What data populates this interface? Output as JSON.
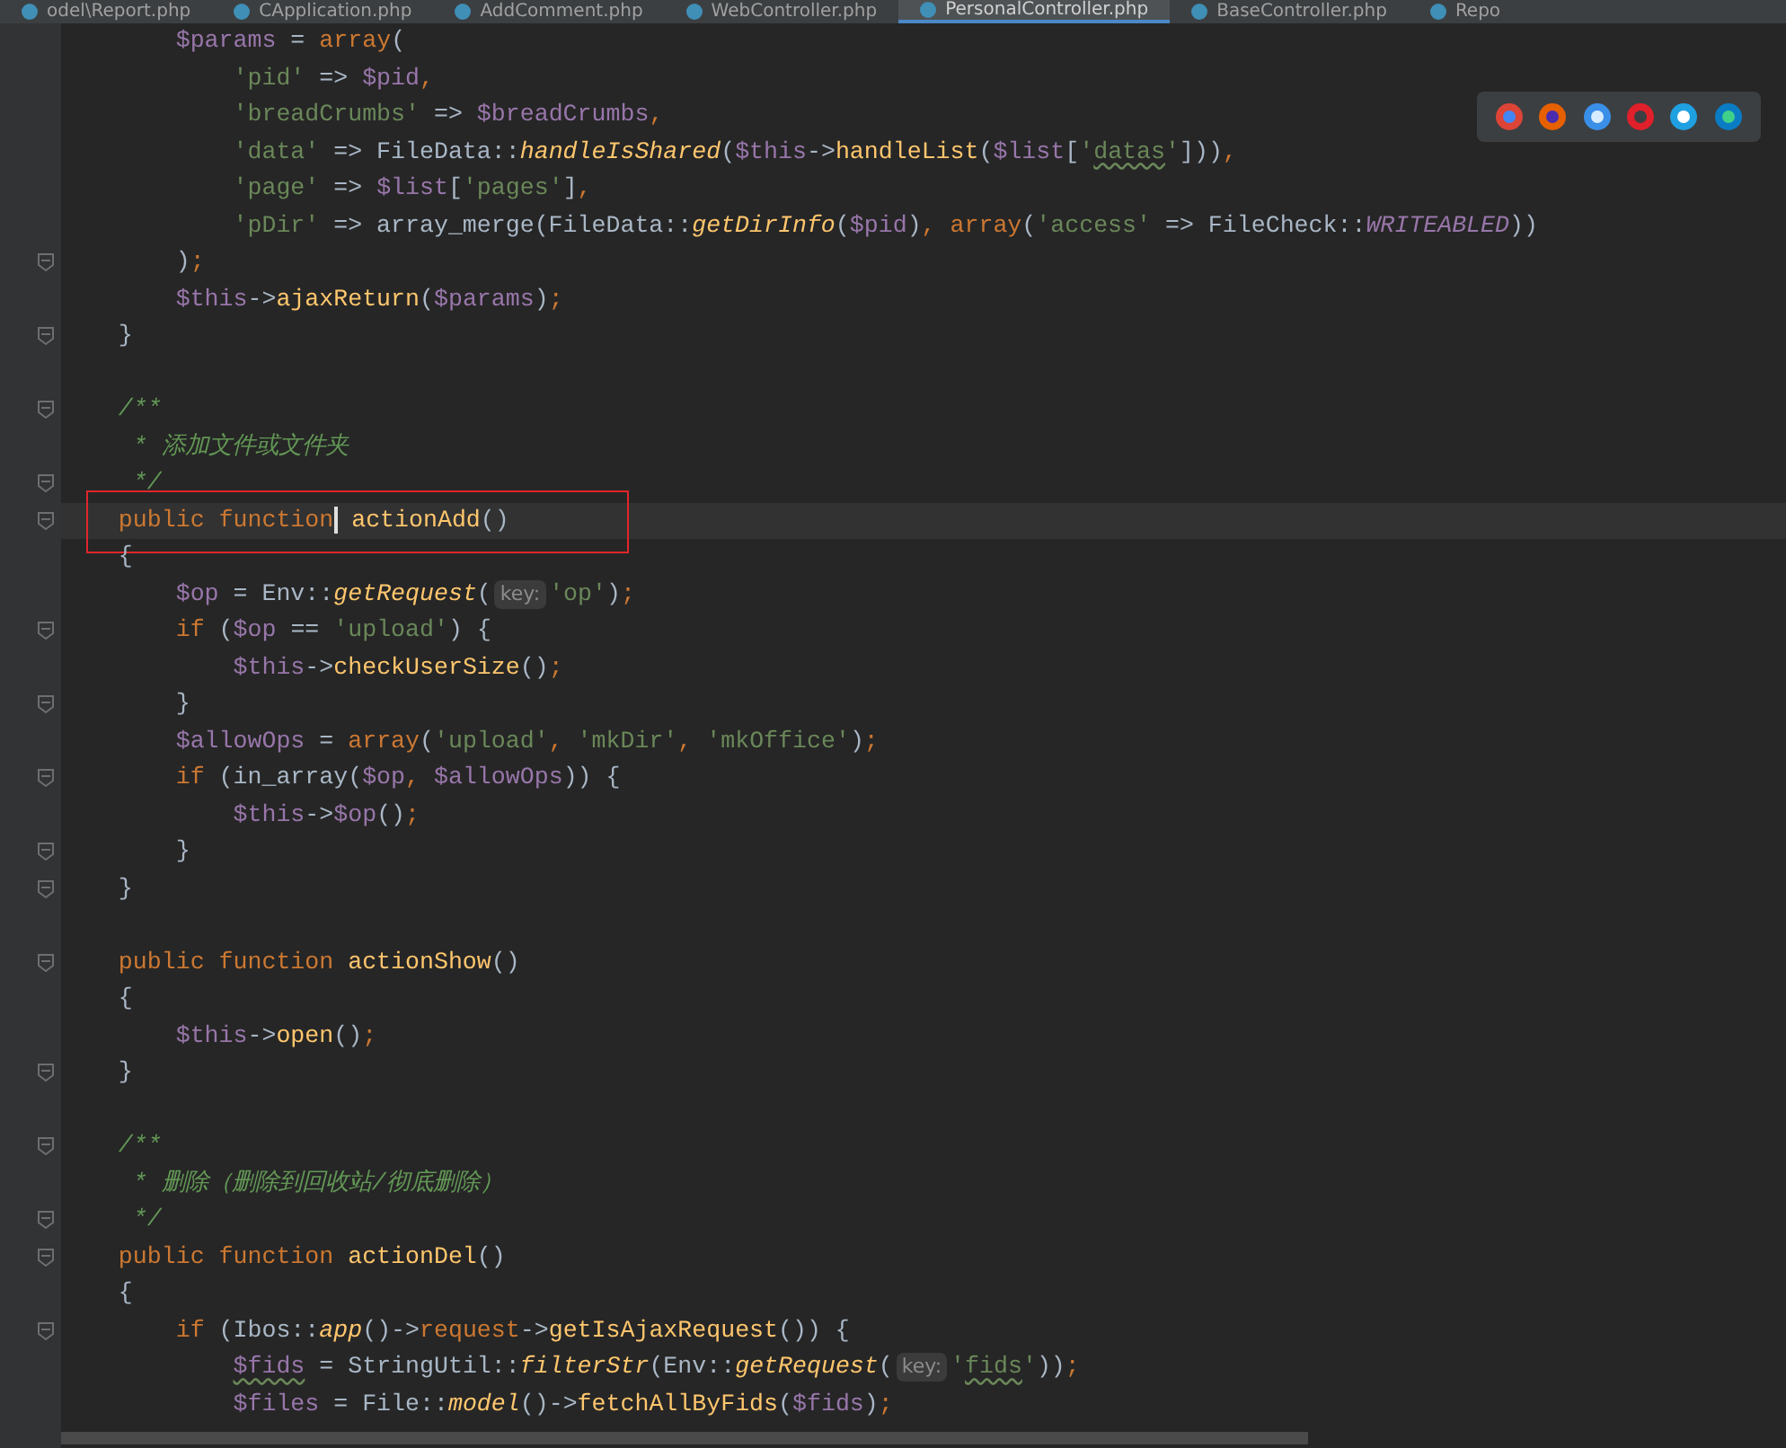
{
  "tabs": [
    {
      "label": "odel\\Report.php",
      "selected": false
    },
    {
      "label": "CApplication.php",
      "selected": false
    },
    {
      "label": "AddComment.php",
      "selected": false
    },
    {
      "label": "WebController.php",
      "selected": false
    },
    {
      "label": "PersonalController.php",
      "selected": true
    },
    {
      "label": "BaseController.php",
      "selected": false
    },
    {
      "label": "Repo",
      "selected": false
    }
  ],
  "editor": {
    "lines": [
      {
        "kind": "code",
        "tokens": [
          {
            "kind": "var",
            "text": "        $params"
          },
          {
            "kind": "plain",
            "text": " = "
          },
          {
            "kind": "keyword",
            "text": "array"
          },
          {
            "kind": "plain",
            "text": "("
          }
        ]
      },
      {
        "kind": "code",
        "tokens": [
          {
            "kind": "string",
            "text": "            'pid'"
          },
          {
            "kind": "plain",
            "text": " => "
          },
          {
            "kind": "var",
            "text": "$pid"
          },
          {
            "kind": "punct",
            "text": ","
          }
        ]
      },
      {
        "kind": "code",
        "tokens": [
          {
            "kind": "string",
            "text": "            'breadCrumbs'"
          },
          {
            "kind": "plain",
            "text": " => "
          },
          {
            "kind": "var",
            "text": "$breadCrumbs"
          },
          {
            "kind": "punct",
            "text": ","
          }
        ]
      },
      {
        "kind": "code",
        "tokens": [
          {
            "kind": "string",
            "text": "            'data'"
          },
          {
            "kind": "plain",
            "text": " => FileData::"
          },
          {
            "kind": "static",
            "text": "handleIsShared"
          },
          {
            "kind": "plain",
            "text": "("
          },
          {
            "kind": "var",
            "text": "$this"
          },
          {
            "kind": "plain",
            "text": "->"
          },
          {
            "kind": "method",
            "text": "handleList"
          },
          {
            "kind": "plain",
            "text": "("
          },
          {
            "kind": "var",
            "text": "$list"
          },
          {
            "kind": "plain",
            "text": "["
          },
          {
            "kind": "string",
            "text": "'"
          },
          {
            "kind": "string",
            "text": "datas",
            "typo": true
          },
          {
            "kind": "string",
            "text": "'"
          },
          {
            "kind": "plain",
            "text": "]))"
          },
          {
            "kind": "punct",
            "text": ","
          }
        ]
      },
      {
        "kind": "code",
        "tokens": [
          {
            "kind": "string",
            "text": "            'page'"
          },
          {
            "kind": "plain",
            "text": " => "
          },
          {
            "kind": "var",
            "text": "$list"
          },
          {
            "kind": "plain",
            "text": "["
          },
          {
            "kind": "string",
            "text": "'pages'"
          },
          {
            "kind": "plain",
            "text": "]"
          },
          {
            "kind": "punct",
            "text": ","
          }
        ]
      },
      {
        "kind": "code",
        "tokens": [
          {
            "kind": "string",
            "text": "            'pDir'"
          },
          {
            "kind": "plain",
            "text": " => array_merge(FileData::"
          },
          {
            "kind": "static",
            "text": "getDirInfo"
          },
          {
            "kind": "plain",
            "text": "("
          },
          {
            "kind": "var",
            "text": "$pid"
          },
          {
            "kind": "plain",
            "text": ")"
          },
          {
            "kind": "punct",
            "text": ","
          },
          {
            "kind": "keyword",
            "text": " array"
          },
          {
            "kind": "plain",
            "text": "("
          },
          {
            "kind": "string",
            "text": "'access'"
          },
          {
            "kind": "plain",
            "text": " => FileCheck::"
          },
          {
            "kind": "constant",
            "text": "WRITEABLED"
          },
          {
            "kind": "plain",
            "text": "))"
          }
        ]
      },
      {
        "kind": "code",
        "fold": true,
        "tokens": [
          {
            "kind": "plain",
            "text": "        )"
          },
          {
            "kind": "punct",
            "text": ";"
          }
        ]
      },
      {
        "kind": "code",
        "tokens": [
          {
            "kind": "var",
            "text": "        $this"
          },
          {
            "kind": "plain",
            "text": "->"
          },
          {
            "kind": "method",
            "text": "ajaxReturn"
          },
          {
            "kind": "plain",
            "text": "("
          },
          {
            "kind": "var",
            "text": "$params"
          },
          {
            "kind": "plain",
            "text": ")"
          },
          {
            "kind": "punct",
            "text": ";"
          }
        ]
      },
      {
        "kind": "code",
        "fold": true,
        "tokens": [
          {
            "kind": "plain",
            "text": "    }"
          }
        ]
      },
      {
        "kind": "blank"
      },
      {
        "kind": "code",
        "fold": true,
        "tokens": [
          {
            "kind": "comment",
            "text": "    /**"
          }
        ]
      },
      {
        "kind": "code",
        "tokens": [
          {
            "kind": "comment",
            "text": "     * 添加文件或文件夹"
          }
        ]
      },
      {
        "kind": "code",
        "fold": true,
        "tokens": [
          {
            "kind": "comment",
            "text": "     */"
          }
        ]
      },
      {
        "kind": "code",
        "fold": true,
        "current": true,
        "boxed": true,
        "tokens": [
          {
            "kind": "keyword",
            "text": "    public function",
            "caret": true
          },
          {
            "kind": "method",
            "text": " actionAdd"
          },
          {
            "kind": "plain",
            "text": "()"
          }
        ]
      },
      {
        "kind": "code",
        "tokens": [
          {
            "kind": "plain",
            "text": "    {"
          }
        ]
      },
      {
        "kind": "code",
        "tokens": [
          {
            "kind": "var",
            "text": "        $op"
          },
          {
            "kind": "plain",
            "text": " = Env::"
          },
          {
            "kind": "static",
            "text": "getRequest"
          },
          {
            "kind": "plain",
            "text": "("
          },
          {
            "kind": "hint",
            "text": "key:"
          },
          {
            "kind": "string",
            "text": "'op'"
          },
          {
            "kind": "plain",
            "text": ")"
          },
          {
            "kind": "punct",
            "text": ";"
          }
        ]
      },
      {
        "kind": "code",
        "fold": true,
        "tokens": [
          {
            "kind": "keyword",
            "text": "        if"
          },
          {
            "kind": "plain",
            "text": " ("
          },
          {
            "kind": "var",
            "text": "$op"
          },
          {
            "kind": "plain",
            "text": " == "
          },
          {
            "kind": "string",
            "text": "'upload'"
          },
          {
            "kind": "plain",
            "text": ") {"
          }
        ]
      },
      {
        "kind": "code",
        "tokens": [
          {
            "kind": "var",
            "text": "            $this"
          },
          {
            "kind": "plain",
            "text": "->"
          },
          {
            "kind": "method",
            "text": "checkUserSize"
          },
          {
            "kind": "plain",
            "text": "()"
          },
          {
            "kind": "punct",
            "text": ";"
          }
        ]
      },
      {
        "kind": "code",
        "fold": true,
        "tokens": [
          {
            "kind": "plain",
            "text": "        }"
          }
        ]
      },
      {
        "kind": "code",
        "tokens": [
          {
            "kind": "var",
            "text": "        $allowOps"
          },
          {
            "kind": "plain",
            "text": " = "
          },
          {
            "kind": "keyword",
            "text": "array"
          },
          {
            "kind": "plain",
            "text": "("
          },
          {
            "kind": "string",
            "text": "'upload'"
          },
          {
            "kind": "punct",
            "text": ","
          },
          {
            "kind": "string",
            "text": " 'mkDir'"
          },
          {
            "kind": "punct",
            "text": ","
          },
          {
            "kind": "string",
            "text": " 'mkOffice'"
          },
          {
            "kind": "plain",
            "text": ")"
          },
          {
            "kind": "punct",
            "text": ";"
          }
        ]
      },
      {
        "kind": "code",
        "fold": true,
        "tokens": [
          {
            "kind": "keyword",
            "text": "        if"
          },
          {
            "kind": "plain",
            "text": " (in_array("
          },
          {
            "kind": "var",
            "text": "$op"
          },
          {
            "kind": "punct",
            "text": ","
          },
          {
            "kind": "var",
            "text": " $allowOps"
          },
          {
            "kind": "plain",
            "text": ")) {"
          }
        ]
      },
      {
        "kind": "code",
        "tokens": [
          {
            "kind": "var",
            "text": "            $this"
          },
          {
            "kind": "plain",
            "text": "->"
          },
          {
            "kind": "var",
            "text": "$op"
          },
          {
            "kind": "plain",
            "text": "()"
          },
          {
            "kind": "punct",
            "text": ";"
          }
        ]
      },
      {
        "kind": "code",
        "fold": true,
        "tokens": [
          {
            "kind": "plain",
            "text": "        }"
          }
        ]
      },
      {
        "kind": "code",
        "fold": true,
        "tokens": [
          {
            "kind": "plain",
            "text": "    }"
          }
        ]
      },
      {
        "kind": "blank"
      },
      {
        "kind": "code",
        "fold": true,
        "tokens": [
          {
            "kind": "keyword",
            "text": "    public function"
          },
          {
            "kind": "method",
            "text": " actionShow"
          },
          {
            "kind": "plain",
            "text": "()"
          }
        ]
      },
      {
        "kind": "code",
        "tokens": [
          {
            "kind": "plain",
            "text": "    {"
          }
        ]
      },
      {
        "kind": "code",
        "tokens": [
          {
            "kind": "var",
            "text": "        $this"
          },
          {
            "kind": "plain",
            "text": "->"
          },
          {
            "kind": "method",
            "text": "open"
          },
          {
            "kind": "plain",
            "text": "()"
          },
          {
            "kind": "punct",
            "text": ";"
          }
        ]
      },
      {
        "kind": "code",
        "fold": true,
        "tokens": [
          {
            "kind": "plain",
            "text": "    }"
          }
        ]
      },
      {
        "kind": "blank"
      },
      {
        "kind": "code",
        "fold": true,
        "tokens": [
          {
            "kind": "comment",
            "text": "    /**"
          }
        ]
      },
      {
        "kind": "code",
        "tokens": [
          {
            "kind": "comment",
            "text": "     * 删除（删除到回收站/彻底删除）"
          }
        ]
      },
      {
        "kind": "code",
        "fold": true,
        "tokens": [
          {
            "kind": "comment",
            "text": "     */"
          }
        ]
      },
      {
        "kind": "code",
        "fold": true,
        "tokens": [
          {
            "kind": "keyword",
            "text": "    public function"
          },
          {
            "kind": "method",
            "text": " actionDel"
          },
          {
            "kind": "plain",
            "text": "()"
          }
        ]
      },
      {
        "kind": "code",
        "tokens": [
          {
            "kind": "plain",
            "text": "    {"
          }
        ]
      },
      {
        "kind": "code",
        "fold": true,
        "tokens": [
          {
            "kind": "keyword",
            "text": "        if"
          },
          {
            "kind": "plain",
            "text": " (Ibos::"
          },
          {
            "kind": "static",
            "text": "app"
          },
          {
            "kind": "plain",
            "text": "()->"
          },
          {
            "kind": "keyword",
            "text": "request"
          },
          {
            "kind": "plain",
            "text": "->"
          },
          {
            "kind": "method",
            "text": "getIsAjaxRequest"
          },
          {
            "kind": "plain",
            "text": "()) {"
          }
        ]
      },
      {
        "kind": "code",
        "tokens": [
          {
            "kind": "var",
            "text": "            $fids",
            "typo": true
          },
          {
            "kind": "plain",
            "text": " = StringUtil::"
          },
          {
            "kind": "static",
            "text": "filterStr"
          },
          {
            "kind": "plain",
            "text": "(Env::"
          },
          {
            "kind": "static",
            "text": "getRequest"
          },
          {
            "kind": "plain",
            "text": "("
          },
          {
            "kind": "hint",
            "text": "key:"
          },
          {
            "kind": "string",
            "text": "'"
          },
          {
            "kind": "string",
            "text": "fids",
            "typo": true
          },
          {
            "kind": "string",
            "text": "'"
          },
          {
            "kind": "plain",
            "text": "))"
          },
          {
            "kind": "punct",
            "text": ";"
          }
        ]
      },
      {
        "kind": "code",
        "tokens": [
          {
            "kind": "var",
            "text": "            $files"
          },
          {
            "kind": "plain",
            "text": " = File::"
          },
          {
            "kind": "static",
            "text": "model"
          },
          {
            "kind": "plain",
            "text": "()->"
          },
          {
            "kind": "method",
            "text": "fetchAllByFids"
          },
          {
            "kind": "plain",
            "text": "("
          },
          {
            "kind": "var",
            "text": "$fids"
          },
          {
            "kind": "plain",
            "text": ")"
          },
          {
            "kind": "punct",
            "text": ";"
          }
        ]
      }
    ]
  }
}
